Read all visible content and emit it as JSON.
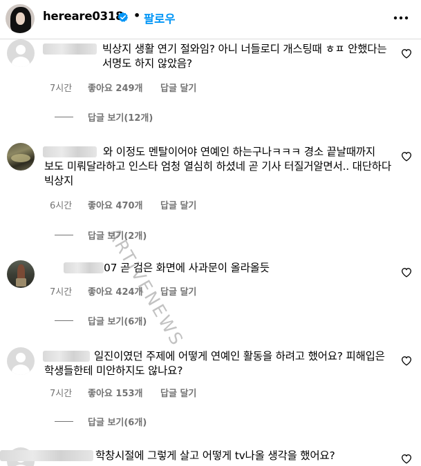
{
  "header": {
    "username": "hereare0318",
    "dot": "•",
    "follow_label": "팔로우"
  },
  "watermark": "ARTIVENEWS",
  "comments": [
    {
      "text": "빅상지 생활 연기 절와임? 아니 너들로디 개스팅때 ㅎㅍ 안했다는 서명도 하지 않았음?",
      "time": "7시간",
      "likes": "좋아요 249개",
      "reply": "답글 달기",
      "view_replies": "답글 보기(12개)"
    },
    {
      "text": "와 이정도 멘탈이어야 연예인 하는구나ㅋㅋㅋ 경소 끝날때까지 보도 미뤄달라하고 인스타 엄청 열심히 하셨네 곧 기사 터질거알면서.. 대단하다 빅상지",
      "time": "6시간",
      "likes": "좋아요 470개",
      "reply": "답글 달기",
      "view_replies": "답글 보기(2개)"
    },
    {
      "text": "07 곧 검은 화면에 사과문이 올라올듯",
      "time": "7시간",
      "likes": "좋아요 424개",
      "reply": "답글 달기",
      "view_replies": "답글 보기(6개)"
    },
    {
      "text": "일진이였던 주제에 어떻게 연예인 활동을 하려고 했어요? 피해입은 학생들한테 미안하지도 않나요?",
      "time": "7시간",
      "likes": "좋아요 153개",
      "reply": "답글 달기",
      "view_replies": "답글 보기(6개)"
    },
    {
      "text": "학창시절에 그렇게 살고 어떻게 tv나올 생각을 했어요?"
    }
  ]
}
